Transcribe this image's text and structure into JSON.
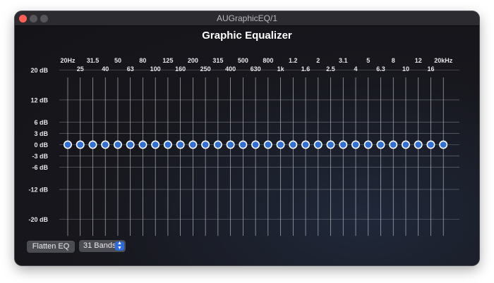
{
  "window": {
    "title": "AUGraphicEQ/1"
  },
  "eq": {
    "title": "Graphic Equalizer",
    "freq_labels_top": [
      "20Hz",
      "31.5",
      "50",
      "80",
      "125",
      "200",
      "315",
      "500",
      "800",
      "1.2",
      "2",
      "3.1",
      "5",
      "8",
      "12",
      "20kHz"
    ],
    "freq_labels_bottom": [
      "25",
      "40",
      "63",
      "100",
      "160",
      "250",
      "400",
      "630",
      "1k",
      "1.6",
      "2.5",
      "4",
      "6.3",
      "10",
      "16"
    ],
    "db_labels": [
      "20 dB",
      "12 dB",
      "6 dB",
      "3 dB",
      "0 dB",
      "-3 dB",
      "-6 dB",
      "-12 dB",
      "-20 dB"
    ],
    "db_values": [
      20,
      12,
      6,
      3,
      0,
      -3,
      -6,
      -12,
      -20
    ],
    "band_count": 31,
    "band_gains_db": [
      0,
      0,
      0,
      0,
      0,
      0,
      0,
      0,
      0,
      0,
      0,
      0,
      0,
      0,
      0,
      0,
      0,
      0,
      0,
      0,
      0,
      0,
      0,
      0,
      0,
      0,
      0,
      0,
      0,
      0,
      0
    ],
    "colors": {
      "handle_fill": "#2f6fd6",
      "handle_ring": "#ffffff",
      "grid": "#8e8e96"
    }
  },
  "controls": {
    "flatten_label": "Flatten EQ",
    "bands_value": "31 Bands"
  }
}
